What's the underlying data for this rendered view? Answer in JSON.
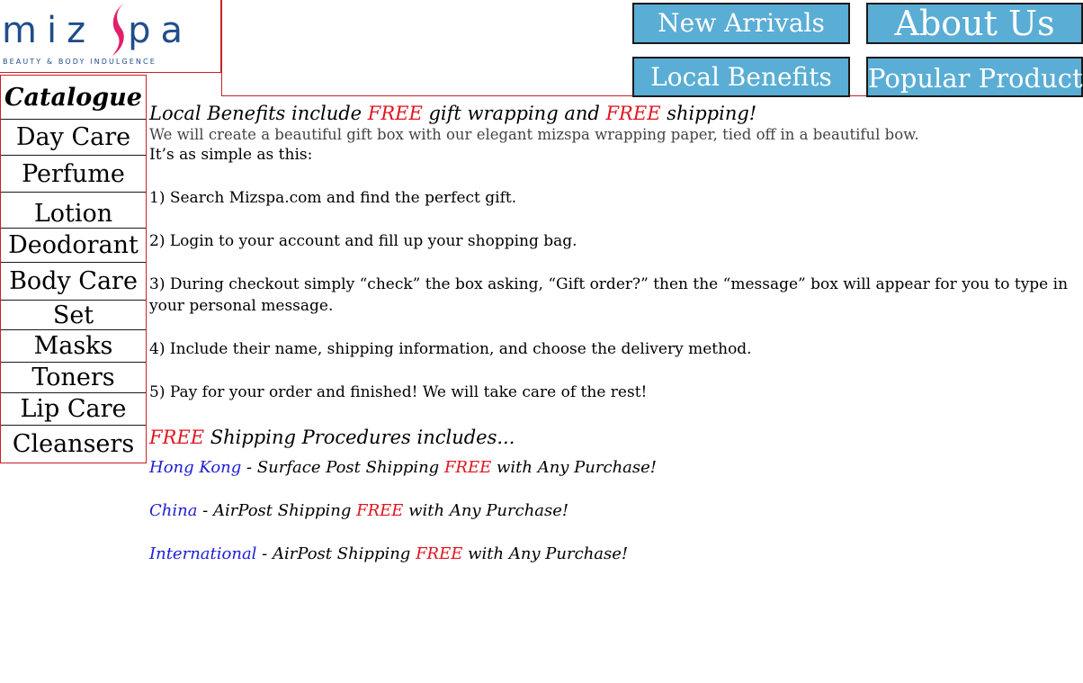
{
  "brand": {
    "logo_text": "mizpa",
    "tagline": "BEAUTY & BODY INDULGENCE",
    "primary_color": "#1f4e8a",
    "accent_color": "#e0206a"
  },
  "nav": {
    "new_arrivals": "New Arrivals",
    "about_us": "About Us",
    "local_benefits": "Local Benefits",
    "popular_products": "Popular Products",
    "button_color": "#5aadd4"
  },
  "sidebar": {
    "heading": "Catalogue",
    "items": [
      {
        "label": "Day Care"
      },
      {
        "label": "Perfume"
      },
      {
        "label": "Lotion"
      },
      {
        "label": "Deodorant"
      },
      {
        "label": "Body Care"
      },
      {
        "label": "Set"
      },
      {
        "label": "Masks"
      },
      {
        "label": "Toners"
      },
      {
        "label": "Lip Care"
      },
      {
        "label": "Cleansers"
      }
    ]
  },
  "content": {
    "title_a": "Local Benefits include ",
    "title_free1": "FREE",
    "title_b": " gift wrapping and ",
    "title_free2": "FREE",
    "title_c": " shipping!",
    "subtitle": "We will create a beautiful gift box with our elegant mizspa wrapping paper, tied off in a beautiful bow.",
    "intro": "It’s as simple as this:",
    "steps": [
      "1) Search Mizspa.com and find the perfect gift.",
      "2) Login to your account and fill up your shopping bag.",
      "3) During checkout simply “check” the box asking, “Gift order?” then the “message” box will appear for you to type in your personal message.",
      "4) Include their name, shipping information, and choose the delivery method.",
      "5) Pay for your order and finished!  We will take care of the rest!"
    ],
    "shipping_head_free": "FREE",
    "shipping_head_rest": " Shipping Procedures includes...",
    "shipping": [
      {
        "region": "Hong Kong",
        "method": " - Surface Post Shipping ",
        "free": "FREE",
        "tail": " with Any Purchase!"
      },
      {
        "region": "China",
        "method": " - AirPost Shipping ",
        "free": "FREE",
        "tail": " with Any Purchase!"
      },
      {
        "region": "International",
        "method": " - AirPost Shipping ",
        "free": "FREE",
        "tail": " with Any Purchase!"
      }
    ],
    "free_color": "#e0141e",
    "region_color": "#1d1dd6"
  }
}
